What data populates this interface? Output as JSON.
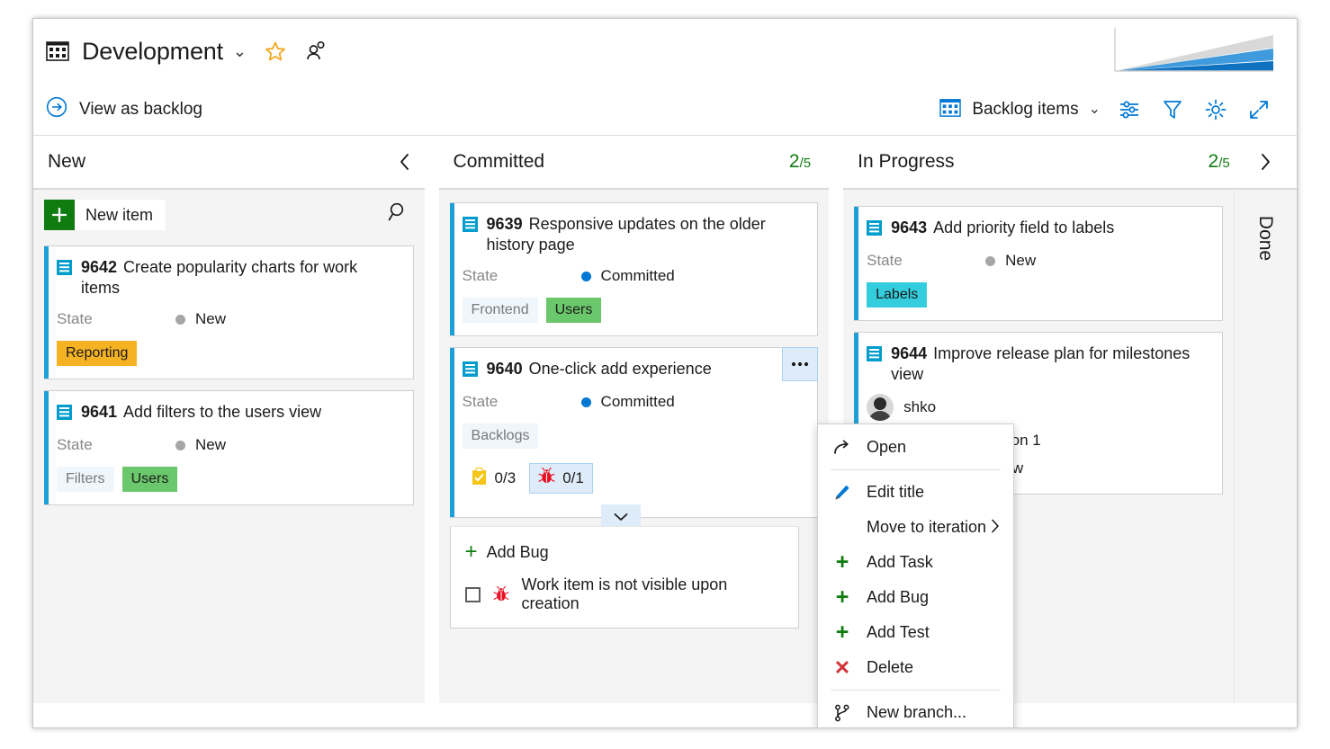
{
  "header": {
    "board_icon": "board-grid-icon",
    "title": "Development",
    "title_chevron": "chevron-down-icon",
    "favorite_icon": "star-icon",
    "team_icon": "people-icon",
    "view_as_backlog": "View as backlog",
    "view_as_backlog_icon": "arrow-circle-right-icon",
    "backlog_items_label": "Backlog items",
    "backlog_items_icon": "board-grid-icon",
    "backlog_items_chevron": "chevron-down-icon",
    "tools": [
      {
        "name": "configure-sliders-icon",
        "title": "Board settings sliders"
      },
      {
        "name": "filter-funnel-icon",
        "title": "Filter"
      },
      {
        "name": "gear-icon",
        "title": "Settings"
      },
      {
        "name": "fullscreen-expand-icon",
        "title": "Enter full screen"
      }
    ],
    "chart_thumbnail": "cumulative-flow-chart-thumbnail"
  },
  "colors": {
    "accent": "#0078d4",
    "card_stripe": "#1f9fd8",
    "wip_ok": "#107c10",
    "state_new_dot": "#a6a6a6",
    "state_committed_dot": "#0078d4",
    "tag_default_bg": "#eff6fc",
    "tag_green_bg": "#6bc76b",
    "tag_orange_bg": "#f5b324",
    "tag_cyan_bg": "#33cdde",
    "column_bg": "#f4f4f4",
    "delete_red": "#d13438"
  },
  "columns": [
    {
      "name": "New",
      "wip_current": "",
      "wip_total": "",
      "collapse_icon": "chevron-left-icon",
      "new_item_label": "New item",
      "new_item_icon": "plus-icon",
      "search_icon": "search-icon",
      "cards": [
        {
          "id": "9642",
          "title": "Create popularity charts for work items",
          "type_icon": "backlog-item-icon",
          "field_label": "State",
          "state": "New",
          "state_dot": "#a6a6a6",
          "tags": [
            {
              "text": "Reporting",
              "bg": "#f5b324"
            }
          ]
        },
        {
          "id": "9641",
          "title": "Add filters to the users view",
          "type_icon": "backlog-item-icon",
          "field_label": "State",
          "state": "New",
          "state_dot": "#a6a6a6",
          "tags": [
            {
              "text": "Filters",
              "bg": "#eff6fc"
            },
            {
              "text": "Users",
              "bg": "#6bc76b"
            }
          ]
        }
      ]
    },
    {
      "name": "Committed",
      "wip_current": "2",
      "wip_total": "/5",
      "cards": [
        {
          "id": "9639",
          "title": "Responsive updates on the older history page",
          "type_icon": "backlog-item-icon",
          "field_label": "State",
          "state": "Committed",
          "state_dot": "#0078d4",
          "tags": [
            {
              "text": "Frontend",
              "bg": "#eff6fc"
            },
            {
              "text": "Users",
              "bg": "#6bc76b"
            }
          ]
        },
        {
          "id": "9640",
          "title": "One-click add experience",
          "type_icon": "backlog-item-icon",
          "field_label": "State",
          "state": "Committed",
          "state_dot": "#0078d4",
          "tags": [
            {
              "text": "Backlogs",
              "bg": "#eff6fc"
            }
          ],
          "menu_icon": "ellipsis-icon",
          "badges": [
            {
              "icon": "task-clipboard-icon",
              "count": "0/3",
              "active": false
            },
            {
              "icon": "bug-icon",
              "count": "0/1",
              "active": true
            }
          ],
          "expand_icon": "chevron-down-icon",
          "add_panel": {
            "add_label": "Add Bug",
            "add_icon": "plus-icon",
            "checkbox_checked": false,
            "checkbox_icon": "bug-icon",
            "checkbox_label": "Work item is not visible upon creation"
          }
        }
      ]
    },
    {
      "name": "In Progress",
      "wip_current": "2",
      "wip_total": "/5",
      "next_icon": "chevron-right-icon",
      "cards": [
        {
          "id": "9643",
          "title": "Add priority field to labels",
          "type_icon": "backlog-item-icon",
          "field_label": "State",
          "state": "New",
          "state_dot": "#a6a6a6",
          "tags": [
            {
              "text": "Labels",
              "bg": "#33cdde"
            }
          ]
        },
        {
          "id": "9644",
          "title": "Improve release plan for milestones view",
          "type_icon": "backlog-item-icon",
          "avatar_icon": "avatar",
          "assignee": "shko",
          "iteration": "Iteration 1",
          "state": "New",
          "state_dot": "#a6a6a6"
        }
      ]
    },
    {
      "name": "Done",
      "collapsed": true
    }
  ],
  "context_menu": {
    "items": [
      {
        "label": "Open",
        "icon": "open-arrow-icon",
        "separator_after": true
      },
      {
        "label": "Edit title",
        "icon": "pencil-icon"
      },
      {
        "label": "Move to iteration",
        "icon": "",
        "submenu_icon": "chevron-right-icon"
      },
      {
        "label": "Add Task",
        "icon": "plus-icon"
      },
      {
        "label": "Add Bug",
        "icon": "plus-icon"
      },
      {
        "label": "Add Test",
        "icon": "plus-icon"
      },
      {
        "label": "Delete",
        "icon": "delete-x-icon",
        "separator_after": true
      },
      {
        "label": "New branch...",
        "icon": "branch-icon"
      }
    ]
  }
}
